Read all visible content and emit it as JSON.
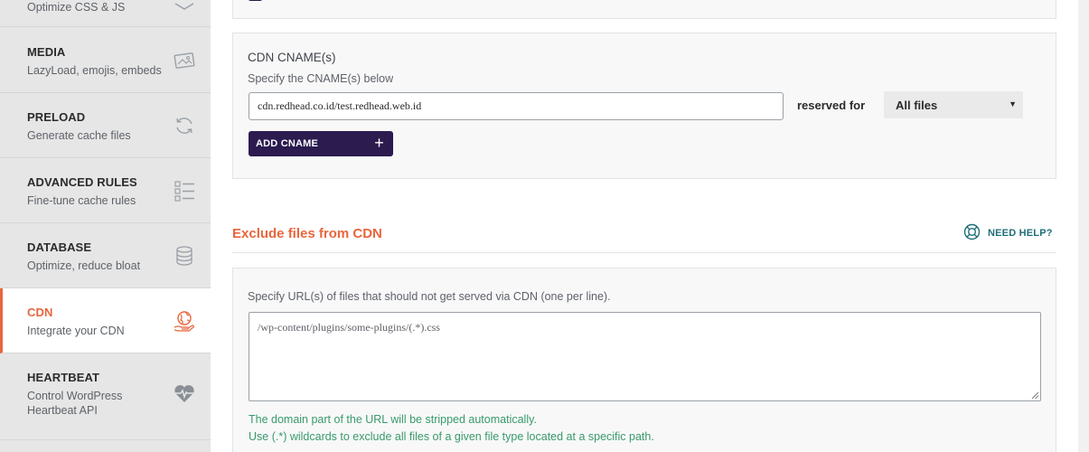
{
  "sidebar": {
    "items": [
      {
        "title": "",
        "subtitle": "Optimize CSS & JS",
        "icon": "code-icon"
      },
      {
        "title": "MEDIA",
        "subtitle": "LazyLoad, emojis, embeds",
        "icon": "image-icon"
      },
      {
        "title": "PRELOAD",
        "subtitle": "Generate cache files",
        "icon": "refresh-icon"
      },
      {
        "title": "ADVANCED RULES",
        "subtitle": "Fine-tune cache rules",
        "icon": "checklist-icon"
      },
      {
        "title": "DATABASE",
        "subtitle": "Optimize, reduce bloat",
        "icon": "database-icon"
      },
      {
        "title": "CDN",
        "subtitle": "Integrate your CDN",
        "icon": "globe-hand-icon",
        "active": true
      },
      {
        "title": "HEARTBEAT",
        "subtitle": "Control WordPress Heartbeat API",
        "icon": "heart-pulse-icon"
      }
    ]
  },
  "cdn_panel": {
    "title": "CDN CNAME(s)",
    "description": "Specify the CNAME(s) below",
    "cname_value": "cdn.redhead.co.id/test.redhead.web.id",
    "reserved_label": "reserved for",
    "reserved_selected": "All files",
    "add_button_label": "ADD CNAME",
    "add_button_icon": "plus-icon"
  },
  "exclude_section": {
    "heading": "Exclude files from CDN",
    "help_label": "NEED HELP?",
    "description": "Specify URL(s) of files that should not get served via CDN (one per line).",
    "textarea_value": "/wp-content/plugins/some-plugins/(.*).css",
    "note_1": "The domain part of the URL will be stripped automatically.",
    "note_2": "Use (.*) wildcards to exclude all files of a given file type located at a specific path."
  },
  "colors": {
    "accent": "#e8663d",
    "primary_button": "#2b1b4f",
    "help_link": "#1f6e78",
    "note_text": "#3a9a6b"
  }
}
